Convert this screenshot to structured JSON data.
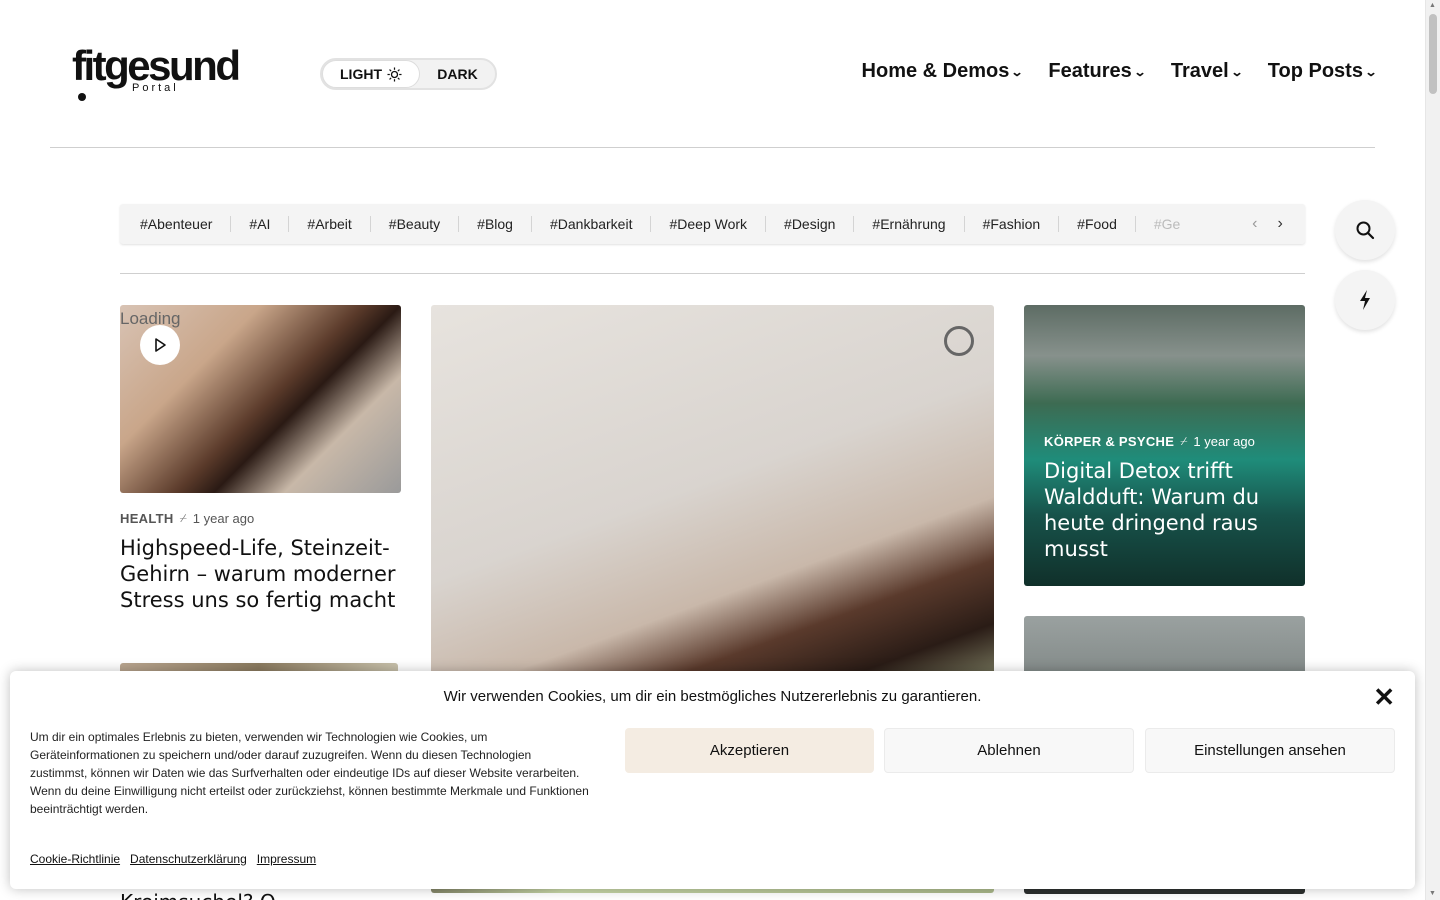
{
  "header": {
    "logo_text": "fitgesund",
    "logo_sub": "Portal",
    "mode_light": "LIGHT",
    "mode_dark": "DARK",
    "nav": [
      {
        "label": "Home & Demos"
      },
      {
        "label": "Features"
      },
      {
        "label": "Travel"
      },
      {
        "label": "Top Posts"
      }
    ]
  },
  "tags": [
    "#Abenteuer",
    "#AI",
    "#Arbeit",
    "#Beauty",
    "#Blog",
    "#Dankbarkeit",
    "#Deep Work",
    "#Design",
    "#Ernährung",
    "#Fashion",
    "#Food",
    "#Ge"
  ],
  "side_buttons": {
    "search": "search-icon",
    "flash": "lightning-icon"
  },
  "cards": {
    "first": {
      "loading": "Loading",
      "category": "HEALTH",
      "time": "1 year ago",
      "title": "Highspeed-Life, Steinzeit-Gehirn – warum moderner Stress uns so fertig macht"
    },
    "third": {
      "category": "KÖRPER & PSYCHE",
      "time": "1 year ago",
      "title": "Digital Detox trifft Waldduft: Warum du heute dringend raus musst"
    },
    "peek_title": "Kreimsuchel? Q"
  },
  "cookie": {
    "title": "Wir verwenden Cookies, um dir ein bestmögliches Nutzererlebnis zu garantieren.",
    "text": "Um dir ein optimales Erlebnis zu bieten, verwenden wir Technologien wie Cookies, um Geräteinformationen zu speichern und/oder darauf zuzugreifen. Wenn du diesen Technologien zustimmst, können wir Daten wie das Surfverhalten oder eindeutige IDs auf dieser Website verarbeiten. Wenn du deine Einwilligung nicht erteilst oder zurückziehst, können bestimmte Merkmale und Funktionen beeinträchtigt werden.",
    "accept": "Akzeptieren",
    "deny": "Ablehnen",
    "settings": "Einstellungen ansehen",
    "links": [
      "Cookie-Richtlinie",
      "Datenschutzerklärung",
      "Impressum"
    ],
    "accept_color": "#f4ece2"
  }
}
